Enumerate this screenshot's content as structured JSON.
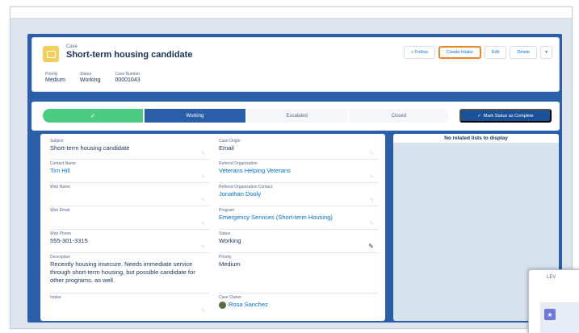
{
  "header": {
    "object_label": "Case",
    "title": "Short-term housing candidate",
    "actions": [
      "+ Follow",
      "Create Intake",
      "Edit",
      "Delete"
    ],
    "more_icon": "chevron-down-icon",
    "highlight_color": "#e8862a",
    "fields": [
      {
        "label": "Priority",
        "value": "Medium"
      },
      {
        "label": "Status",
        "value": "Working"
      },
      {
        "label": "Case Number",
        "value": "00001043"
      }
    ]
  },
  "path": {
    "steps": [
      "",
      "Working",
      "Escalated",
      "Closed"
    ],
    "mark_button": "Mark Status as Complete",
    "complete_color": "#4bca81",
    "current_color": "#2a5ea8"
  },
  "details": {
    "left": [
      {
        "label": "Subject",
        "value": "Short-term housing candidate"
      },
      {
        "label": "Contact Name",
        "value": "Tim Hill"
      },
      {
        "label": "Web Name",
        "value": ""
      },
      {
        "label": "Web Email",
        "value": ""
      },
      {
        "label": "Web Phone",
        "value": "555-301-3315"
      },
      {
        "label": "Description",
        "value": "Recently housing insecure. Needs immediate service through short-term housing, but possible candidate for other programs, as well."
      },
      {
        "label": "Intake",
        "value": ""
      }
    ],
    "right": [
      {
        "label": "Case Origin",
        "value": "Email"
      },
      {
        "label": "Referral Organization",
        "value": "Veterans Helping Veterans"
      },
      {
        "label": "Referral Organization Contact",
        "value": "Jonathan Dooly"
      },
      {
        "label": "Program",
        "value": "Emergency Services (Short-term Housing)"
      },
      {
        "label": "Status",
        "value": "Working"
      },
      {
        "label": "Priority",
        "value": "Medium"
      },
      {
        "label": "Case Owner",
        "value": "Rosa Sanchez"
      }
    ]
  },
  "related": {
    "empty_message": "No related lists to display"
  },
  "popup": {
    "partial_text": "LEV"
  }
}
